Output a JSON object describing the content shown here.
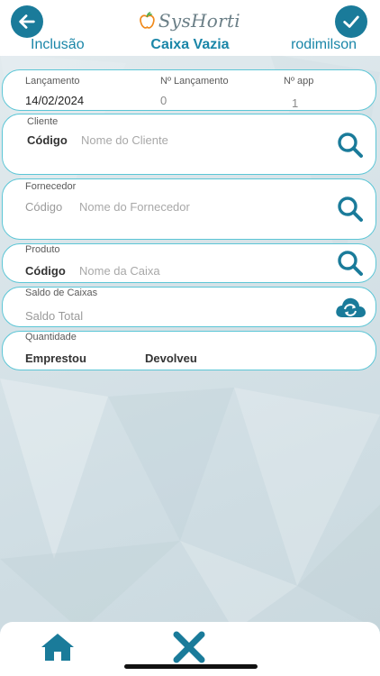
{
  "header": {
    "brand": "SysHorti",
    "mode": "Inclusão",
    "title": "Caixa Vazia",
    "user": "rodimilson"
  },
  "launch": {
    "date_label": "Lançamento",
    "date_value": "14/02/2024",
    "number_label": "Nº Lançamento",
    "number_value": "0",
    "app_label": "Nº app",
    "app_value": "1"
  },
  "client": {
    "section_label": "Cliente",
    "code_label": "Código",
    "name_placeholder": "Nome do Cliente"
  },
  "supplier": {
    "section_label": "Fornecedor",
    "code_label": "Código",
    "name_placeholder": "Nome do Fornecedor"
  },
  "product": {
    "section_label": "Produto",
    "code_label": "Código",
    "name_placeholder": "Nome da Caixa"
  },
  "balance": {
    "section_label": "Saldo de Caixas",
    "total_label": "Saldo Total"
  },
  "quantity": {
    "section_label": "Quantidade",
    "lent_label": "Emprestou",
    "returned_label": "Devolveu"
  },
  "colors": {
    "accent": "#1a7b9a",
    "header_text": "#1a86a8",
    "card_border": "#5cc6d6"
  },
  "icons": {
    "back": "arrow-left-icon",
    "confirm": "check-icon",
    "search": "search-icon",
    "refresh": "cloud-refresh-icon",
    "home": "home-icon",
    "close": "close-icon"
  }
}
